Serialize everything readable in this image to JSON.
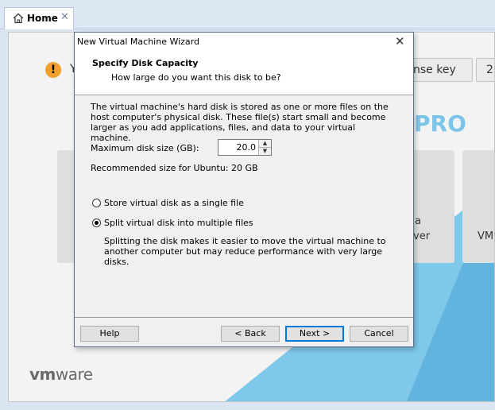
{
  "tabs": {
    "home_label": "Home",
    "close_glyph": "✕"
  },
  "home": {
    "warning_glyph": "!",
    "partial_text_1": "Y",
    "license_button": "nse key",
    "partial_button_2": "2",
    "brand_fragment": "PRO",
    "card_text_a": "a",
    "card_text_b": "ver",
    "card_text_c": "VM",
    "logo": {
      "vm": "vm",
      "ware": "ware"
    }
  },
  "dialog": {
    "title": "New Virtual Machine Wizard",
    "close_glyph": "✕",
    "heading": "Specify Disk Capacity",
    "subheading": "How large do you want this disk to be?",
    "intro": "The virtual machine's hard disk is stored as one or more files on the host computer's physical disk. These file(s) start small and become larger as you add applications, files, and data to your virtual machine.",
    "max_size_label": "Maximum disk size (GB):",
    "max_size_value": "20.0",
    "recommended": "Recommended size for Ubuntu: 20 GB",
    "options": [
      {
        "label": "Store virtual disk as a single file",
        "selected": false
      },
      {
        "label": "Split virtual disk into multiple files",
        "selected": true
      }
    ],
    "split_description": "Splitting the disk makes it easier to move the virtual machine to another computer but may reduce performance with very large disks.",
    "buttons": {
      "help": "Help",
      "back": "< Back",
      "next": "Next >",
      "cancel": "Cancel"
    }
  },
  "colors": {
    "accent": "#0078d7",
    "brand_blue": "#7cc5e8",
    "warning": "#f0a12b"
  }
}
